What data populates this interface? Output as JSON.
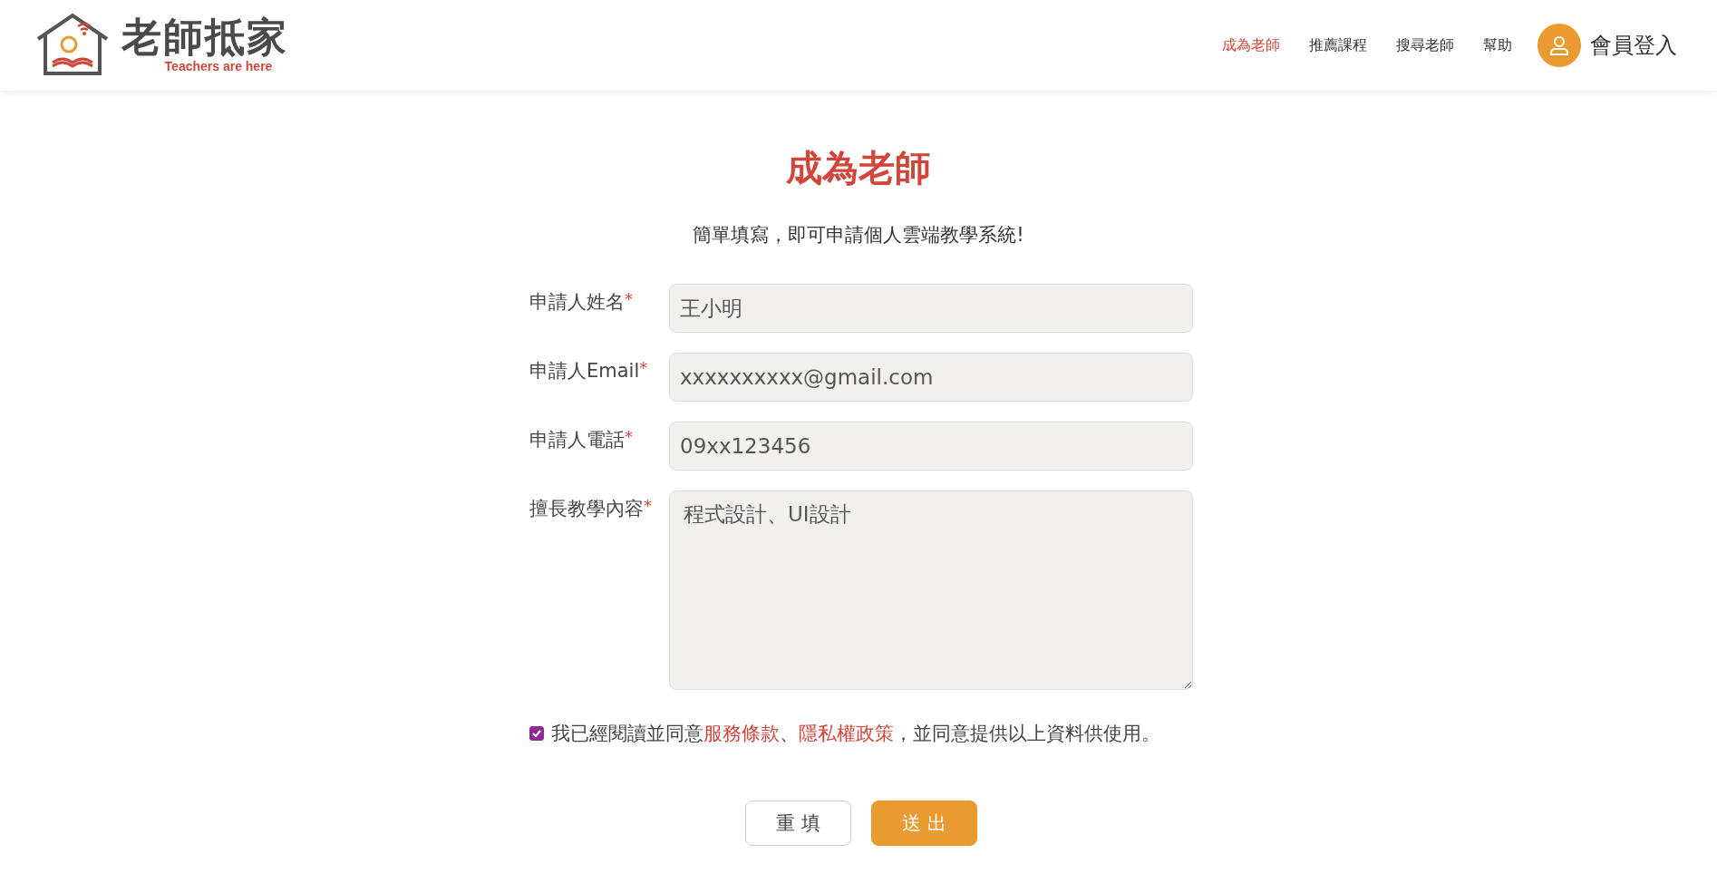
{
  "header": {
    "logo": {
      "title": "老師抵家",
      "tagline": "Teachers are here"
    },
    "nav": [
      {
        "label": "成為老師",
        "selected": true
      },
      {
        "label": "推薦課程",
        "selected": false
      },
      {
        "label": "搜尋老師",
        "selected": false
      },
      {
        "label": "幫助",
        "selected": false
      }
    ],
    "login": {
      "label": "會員登入"
    }
  },
  "page": {
    "title": "成為老師",
    "subtitle": "簡單填寫，即可申請個人雲端教學系統!"
  },
  "form": {
    "fields": [
      {
        "kind": "input",
        "label": "申請人姓名",
        "mark": "*",
        "value": "王小明"
      },
      {
        "kind": "input",
        "label": "申請人Email",
        "mark": "*",
        "value": "xxxxxxxxxx@gmail.com"
      },
      {
        "kind": "input",
        "label": "申請人電話",
        "mark": "*",
        "value": "09xx123456"
      },
      {
        "kind": "textarea",
        "label": "擅長教學內容",
        "mark": "*",
        "value": "程式設計、UI設計"
      }
    ],
    "agreement": {
      "checked": true,
      "parts": [
        {
          "kind": "text",
          "text": "我已經閱讀並同意"
        },
        {
          "kind": "link",
          "text": "服務條款"
        },
        {
          "kind": "text",
          "text": "、"
        },
        {
          "kind": "link",
          "text": "隱私權政策"
        },
        {
          "kind": "text",
          "text": "，並同意提供以上資料供使用。"
        }
      ]
    },
    "buttons": [
      {
        "kind": "secondary",
        "label": "重 填"
      },
      {
        "kind": "primary",
        "label": "送 出"
      }
    ]
  }
}
